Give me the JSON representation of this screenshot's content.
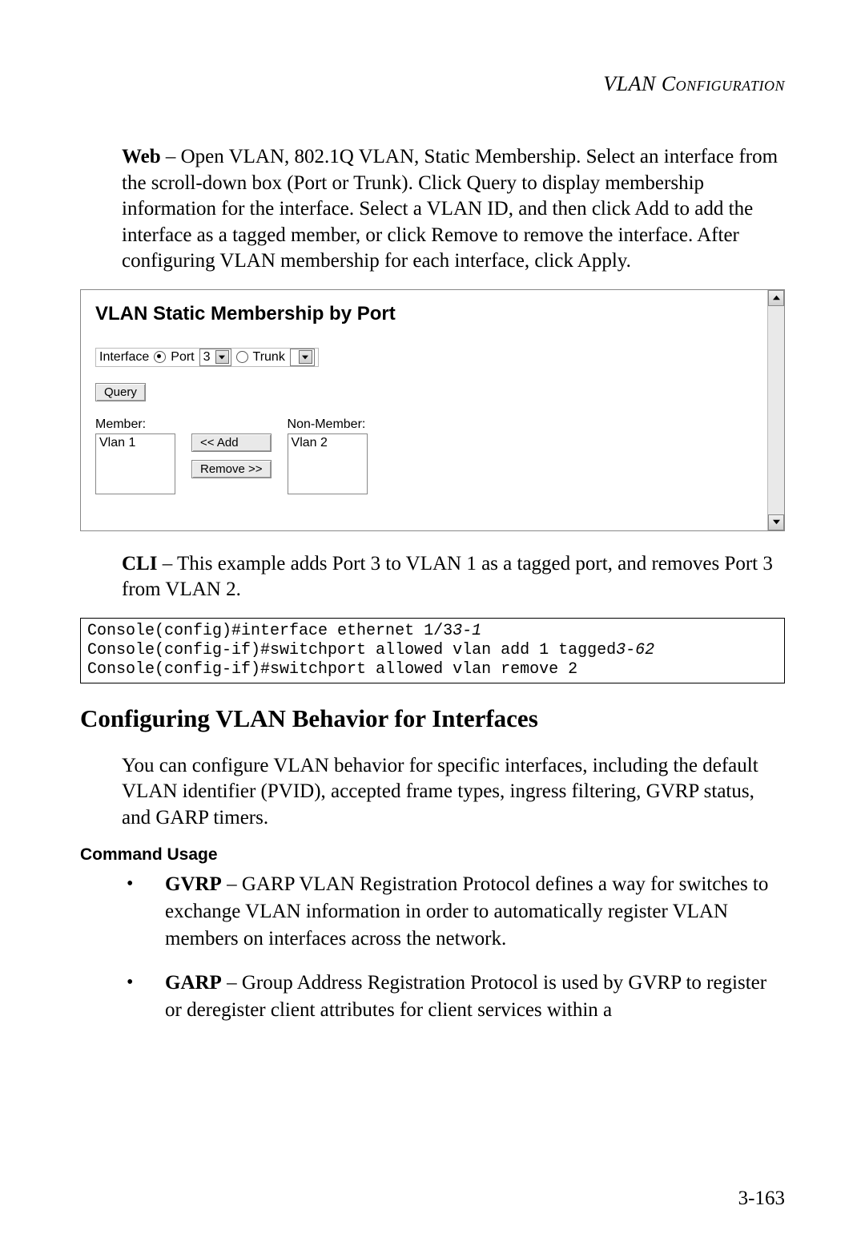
{
  "header": {
    "title": "VLAN Configuration"
  },
  "para_web": {
    "lead": "Web",
    "text": " – Open VLAN, 802.1Q VLAN, Static Membership. Select an interface from the scroll-down box (Port or Trunk). Click Query to display membership information for the interface. Select a VLAN ID, and then click Add to add the interface as a tagged member, or click Remove to remove the interface. After configuring VLAN membership for each interface, click Apply."
  },
  "screenshot": {
    "title": "VLAN Static Membership by Port",
    "interface_label": "Interface",
    "port_label": "Port",
    "port_value": "3",
    "trunk_label": "Trunk",
    "trunk_value": "",
    "query_btn": "Query",
    "member_label": "Member:",
    "nonmember_label": "Non-Member:",
    "member_item": "Vlan 1",
    "nonmember_item": "Vlan 2",
    "add_btn": "<< Add",
    "remove_btn": "Remove >>"
  },
  "para_cli": {
    "lead": "CLI",
    "text": " – This example adds Port 3 to VLAN 1 as a tagged port, and removes Port 3 from VLAN 2."
  },
  "cli": {
    "line1a": "Console(config)#interface ethernet 1/3",
    "line1b": "3-1",
    "line2a": "Console(config-if)#switchport allowed vlan add 1 tagged",
    "line2b": "3-62",
    "line3": "Console(config-if)#switchport allowed vlan remove 2"
  },
  "h2": "Configuring VLAN Behavior for Interfaces",
  "para_behav": "You can configure VLAN behavior for specific interfaces, including the default VLAN identifier (PVID), accepted frame types, ingress filtering, GVRP status, and GARP timers.",
  "h3": "Command Usage",
  "bullets": {
    "gvrp_lead": "GVRP",
    "gvrp_text": " – GARP VLAN Registration Protocol defines a way for switches to exchange VLAN information in order to automatically register VLAN members on interfaces across the network.",
    "garp_lead": "GARP",
    "garp_text": " – Group Address Registration Protocol is used by GVRP to register or deregister client attributes for client services within a"
  },
  "page_number": "3-163"
}
